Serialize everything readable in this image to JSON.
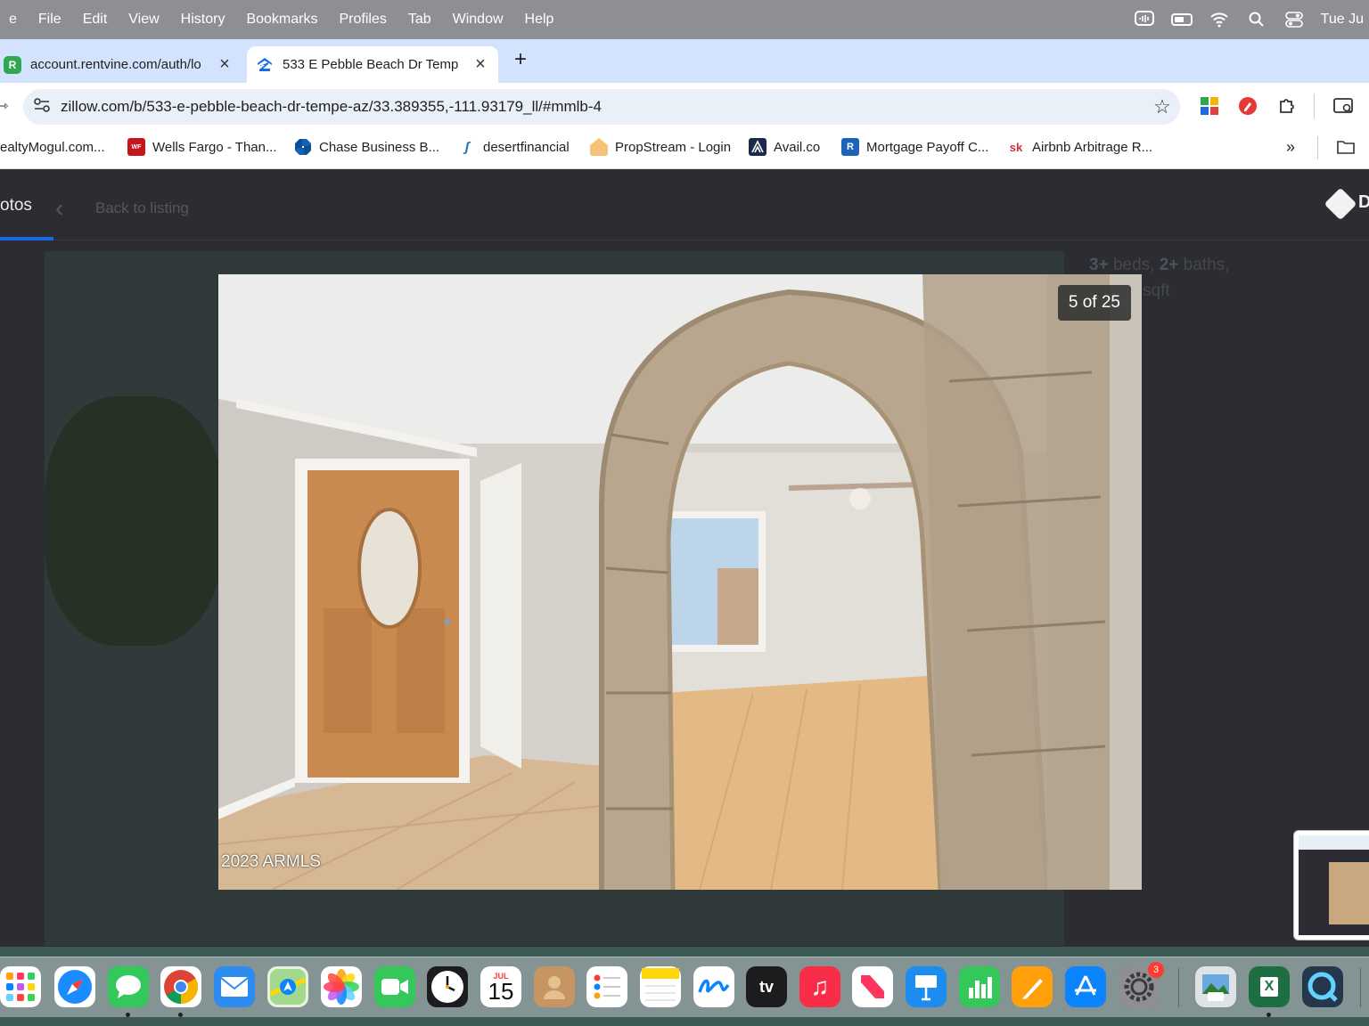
{
  "menubar": {
    "items": [
      "e",
      "File",
      "Edit",
      "View",
      "History",
      "Bookmarks",
      "Profiles",
      "Tab",
      "Window",
      "Help"
    ],
    "clock": "Tue Ju"
  },
  "tabs": [
    {
      "title": "account.rentvine.com/auth/lo",
      "active": false
    },
    {
      "title": "533 E Pebble Beach Dr Temp",
      "active": true
    }
  ],
  "toolbar": {
    "url": "zillow.com/b/533-e-pebble-beach-dr-tempe-az/33.389355,-111.93179_ll/#mmlb-4"
  },
  "bookmarks": [
    {
      "label": "ealtyMogul.com..."
    },
    {
      "label": "Wells Fargo - Than..."
    },
    {
      "label": "Chase Business B..."
    },
    {
      "label": "desertfinancial"
    },
    {
      "label": "PropStream - Login"
    },
    {
      "label": "Avail.co"
    },
    {
      "label": "Mortgage Payoff C..."
    },
    {
      "label": "Airbnb Arbitrage R..."
    }
  ],
  "page": {
    "photos_tab": "otos",
    "back_label": "Back to listing",
    "dir_letter": "D",
    "facts": {
      "beds_num": "3+",
      "beds_label": "beds,",
      "baths_num": "2+",
      "baths_label": "baths,",
      "sqft_label": "sqft"
    },
    "photo": {
      "counter": "5 of 25",
      "watermark": "2023 ARMLS"
    }
  },
  "dock": {
    "calendar_month": "JUL",
    "calendar_day": "15",
    "settings_badge": "3",
    "tv_label": "tv"
  },
  "colors": {
    "tabstrip": "#d3e3fd",
    "accent": "#1b6ae0",
    "page_bg": "#2b2d33"
  }
}
